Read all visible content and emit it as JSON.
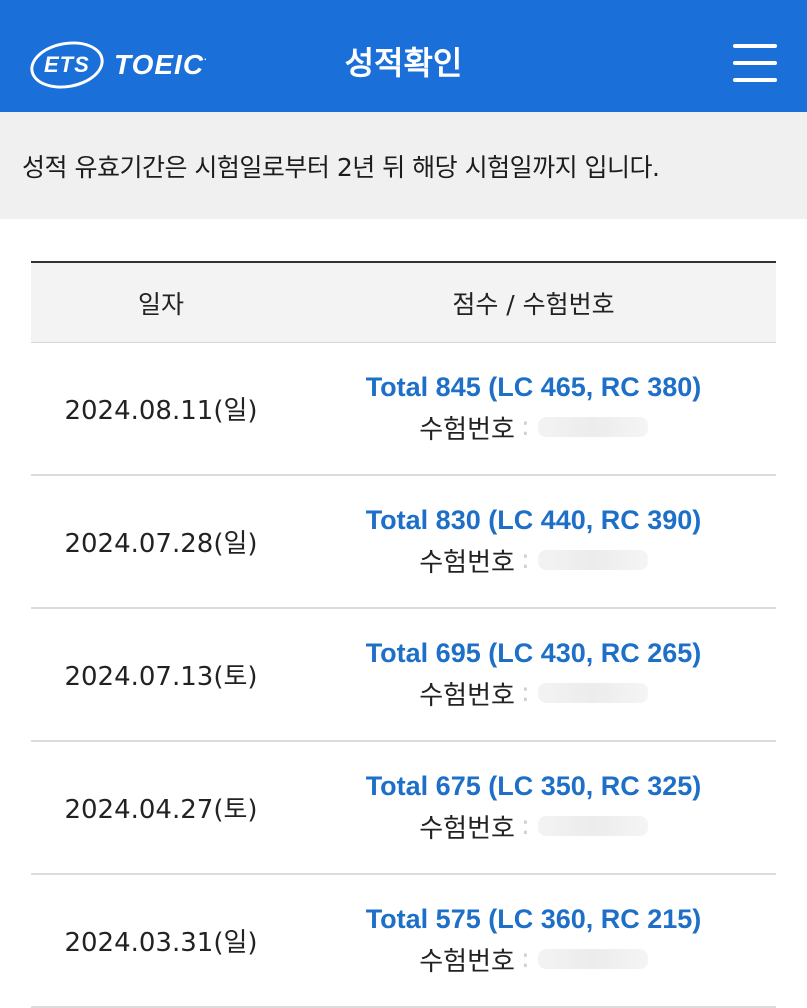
{
  "header": {
    "logo_ets": "ETS",
    "logo_toeic": "TOEIC",
    "title": "성적확인",
    "brand_color": "#1a6fd9"
  },
  "notice": {
    "text": "성적 유효기간은 시험일로부터 2년 뒤 해당 시험일까지 입니다."
  },
  "table": {
    "headers": [
      "일자",
      "점수 / 수험번호"
    ],
    "exam_label": "수험번호",
    "rows": [
      {
        "date": "2024.08.11(일)",
        "score": "Total 845 (LC 465, RC 380)"
      },
      {
        "date": "2024.07.28(일)",
        "score": "Total 830 (LC 440, RC 390)"
      },
      {
        "date": "2024.07.13(토)",
        "score": "Total 695 (LC 430, RC 265)"
      },
      {
        "date": "2024.04.27(토)",
        "score": "Total 675 (LC 350, RC 325)"
      },
      {
        "date": "2024.03.31(일)",
        "score": "Total 575 (LC 360, RC 215)"
      }
    ],
    "score_color": "#1e6fc8"
  }
}
